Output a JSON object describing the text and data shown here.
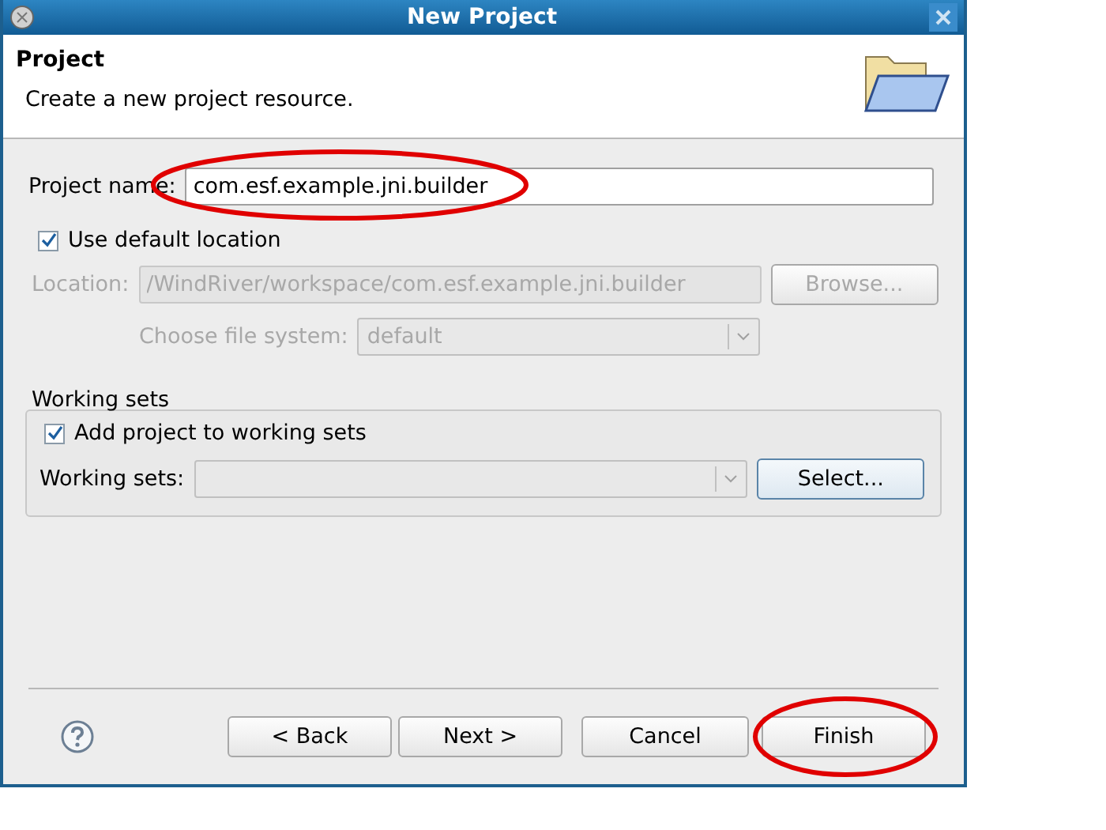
{
  "window": {
    "title": "New Project"
  },
  "header": {
    "title": "Project",
    "description": "Create a new project resource."
  },
  "project_name": {
    "label": "Project name:",
    "value": "com.esf.example.jni.builder",
    "highlighted": true
  },
  "use_default_location": {
    "label": "Use default location",
    "checked": true
  },
  "location": {
    "label": "Location:",
    "value": "/WindRiver/workspace/com.esf.example.jni.builder",
    "disabled": true,
    "browse": "Browse..."
  },
  "file_system": {
    "label": "Choose file system:",
    "value": "default",
    "disabled": true
  },
  "working_sets": {
    "title": "Working sets",
    "add": {
      "label": "Add project to working sets",
      "checked": true
    },
    "label": "Working sets:",
    "select": "Select..."
  },
  "buttons": [
    {
      "label": "< Back",
      "highlighted": false
    },
    {
      "label": "Next >",
      "highlighted": false
    },
    {
      "label": "Cancel",
      "highlighted": false
    },
    {
      "label": "Finish",
      "highlighted": true
    }
  ]
}
